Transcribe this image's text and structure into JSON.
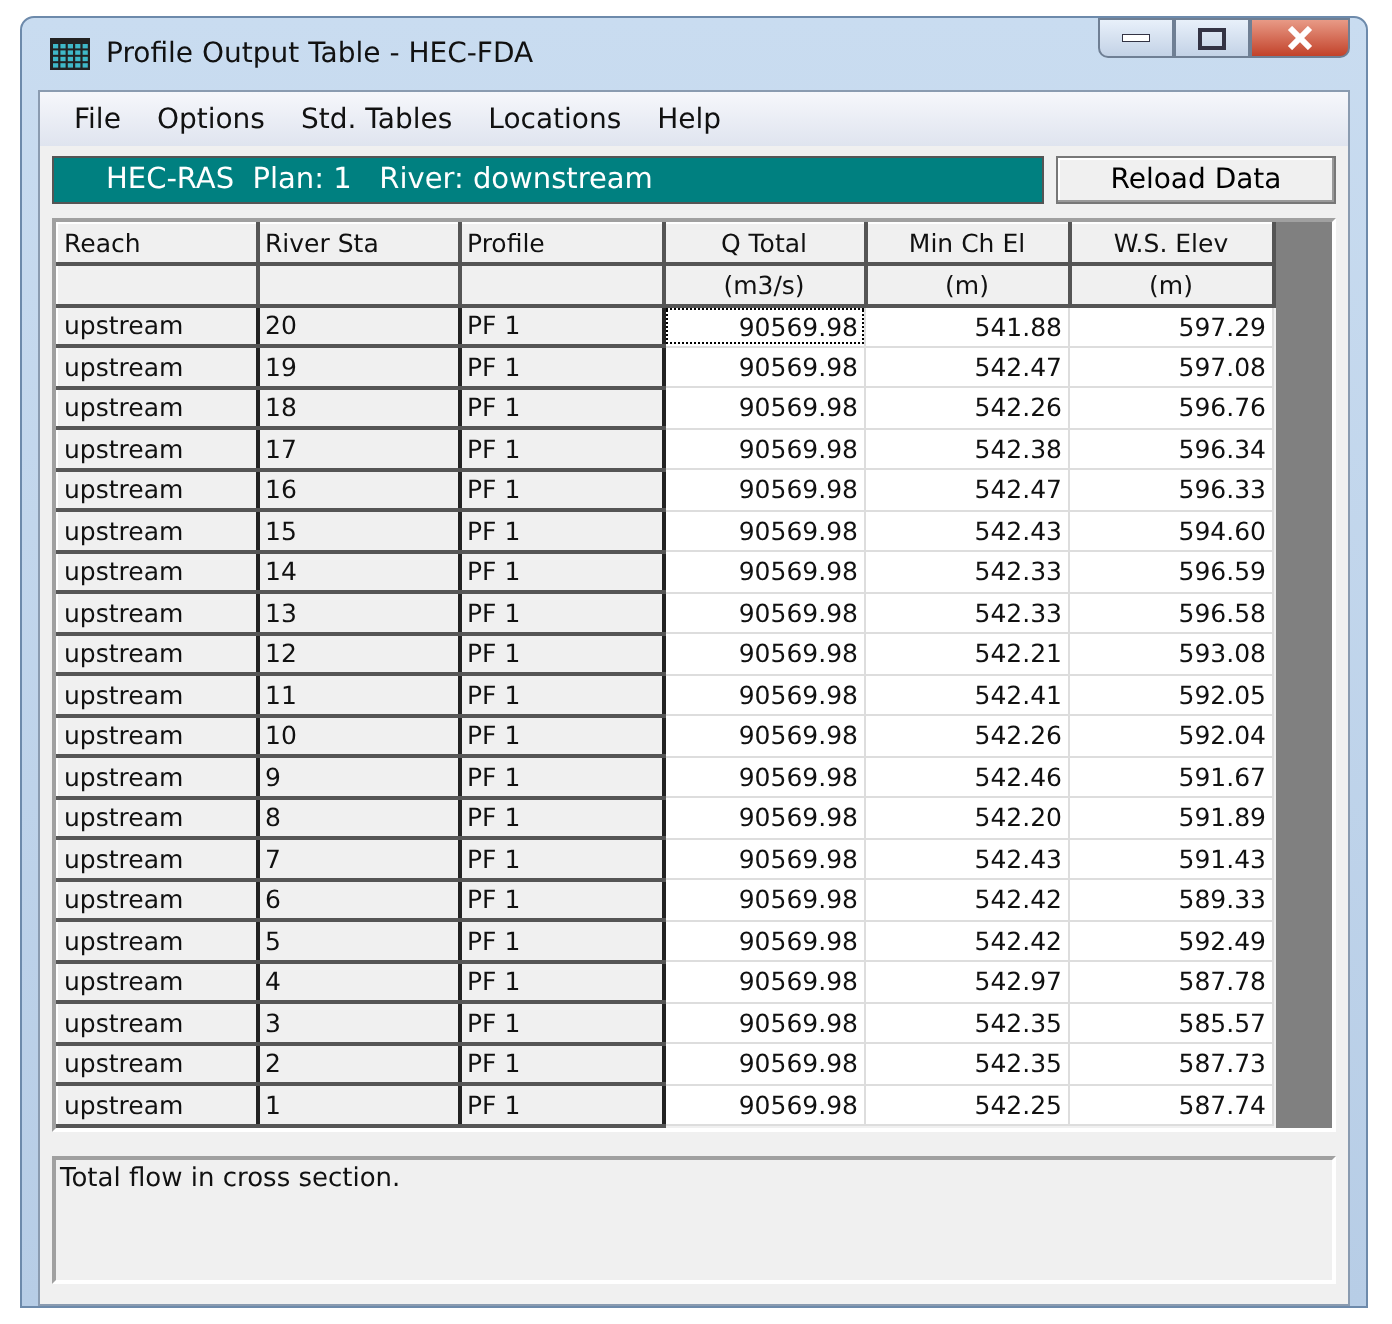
{
  "window": {
    "title": "Profile Output Table - HEC-FDA"
  },
  "menu": [
    "File",
    "Options",
    "Std. Tables",
    "Locations",
    "Help"
  ],
  "info_bar": "HEC-RAS  Plan: 1   River: downstream",
  "reload_button": "Reload Data",
  "table": {
    "columns": [
      {
        "title": "Reach"
      },
      {
        "title": "River Sta"
      },
      {
        "title": "Profile"
      },
      {
        "title": "Q Total",
        "unit": "(m3/s)"
      },
      {
        "title": "Min Ch El",
        "unit": "(m)"
      },
      {
        "title": "W.S. Elev",
        "unit": "(m)"
      }
    ],
    "rows": [
      {
        "cells": [
          "upstream",
          "20",
          "PF 1",
          "90569.98",
          "541.88",
          "597.29"
        ],
        "focused": true
      },
      {
        "cells": [
          "upstream",
          "19",
          "PF 1",
          "90569.98",
          "542.47",
          "597.08"
        ],
        "focused": false
      },
      {
        "cells": [
          "upstream",
          "18",
          "PF 1",
          "90569.98",
          "542.26",
          "596.76"
        ],
        "focused": false
      },
      {
        "cells": [
          "upstream",
          "17",
          "PF 1",
          "90569.98",
          "542.38",
          "596.34"
        ],
        "focused": false
      },
      {
        "cells": [
          "upstream",
          "16",
          "PF 1",
          "90569.98",
          "542.47",
          "596.33"
        ],
        "focused": false
      },
      {
        "cells": [
          "upstream",
          "15",
          "PF 1",
          "90569.98",
          "542.43",
          "594.60"
        ],
        "focused": false
      },
      {
        "cells": [
          "upstream",
          "14",
          "PF 1",
          "90569.98",
          "542.33",
          "596.59"
        ],
        "focused": false
      },
      {
        "cells": [
          "upstream",
          "13",
          "PF 1",
          "90569.98",
          "542.33",
          "596.58"
        ],
        "focused": false
      },
      {
        "cells": [
          "upstream",
          "12",
          "PF 1",
          "90569.98",
          "542.21",
          "593.08"
        ],
        "focused": false
      },
      {
        "cells": [
          "upstream",
          "11",
          "PF 1",
          "90569.98",
          "542.41",
          "592.05"
        ],
        "focused": false
      },
      {
        "cells": [
          "upstream",
          "10",
          "PF 1",
          "90569.98",
          "542.26",
          "592.04"
        ],
        "focused": false
      },
      {
        "cells": [
          "upstream",
          "9",
          "PF 1",
          "90569.98",
          "542.46",
          "591.67"
        ],
        "focused": false
      },
      {
        "cells": [
          "upstream",
          "8",
          "PF 1",
          "90569.98",
          "542.20",
          "591.89"
        ],
        "focused": false
      },
      {
        "cells": [
          "upstream",
          "7",
          "PF 1",
          "90569.98",
          "542.43",
          "591.43"
        ],
        "focused": false
      },
      {
        "cells": [
          "upstream",
          "6",
          "PF 1",
          "90569.98",
          "542.42",
          "589.33"
        ],
        "focused": false
      },
      {
        "cells": [
          "upstream",
          "5",
          "PF 1",
          "90569.98",
          "542.42",
          "592.49"
        ],
        "focused": false
      },
      {
        "cells": [
          "upstream",
          "4",
          "PF 1",
          "90569.98",
          "542.97",
          "587.78"
        ],
        "focused": false
      },
      {
        "cells": [
          "upstream",
          "3",
          "PF 1",
          "90569.98",
          "542.35",
          "585.57"
        ],
        "focused": false
      },
      {
        "cells": [
          "upstream",
          "2",
          "PF 1",
          "90569.98",
          "542.35",
          "587.73"
        ],
        "focused": false
      },
      {
        "cells": [
          "upstream",
          "1",
          "PF 1",
          "90569.98",
          "542.25",
          "587.74"
        ],
        "focused": false
      }
    ]
  },
  "status_text": "Total flow in cross section."
}
